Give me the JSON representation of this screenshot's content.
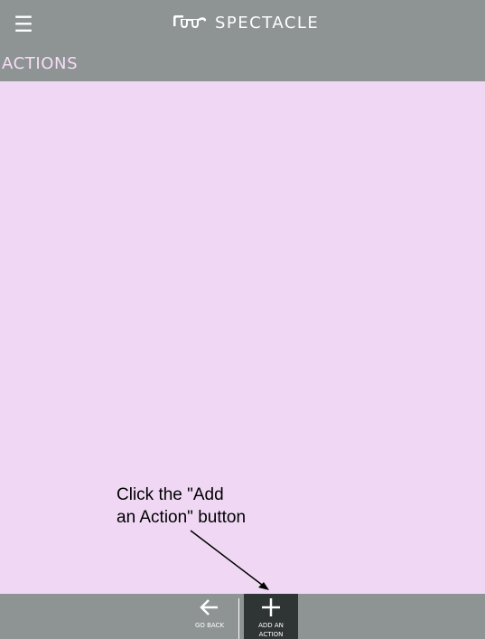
{
  "header": {
    "menu_icon": "hamburger-icon",
    "logo_icon": "spectacles-logo-icon",
    "brand_name": "SPECTACLE"
  },
  "section": {
    "title": "ACTIONS"
  },
  "annotation": {
    "line1": "Click the \"Add",
    "line2": "an Action\" button"
  },
  "bottom_nav": {
    "go_back": {
      "icon": "arrow-left-icon",
      "label": "GO BACK"
    },
    "add_action": {
      "icon": "plus-icon",
      "label": "ADD AN ACTION"
    }
  },
  "colors": {
    "bar": "#8e9393",
    "content_bg": "#f0d8f5",
    "active_button": "#2f3434",
    "title_text": "#f7ddf7"
  }
}
